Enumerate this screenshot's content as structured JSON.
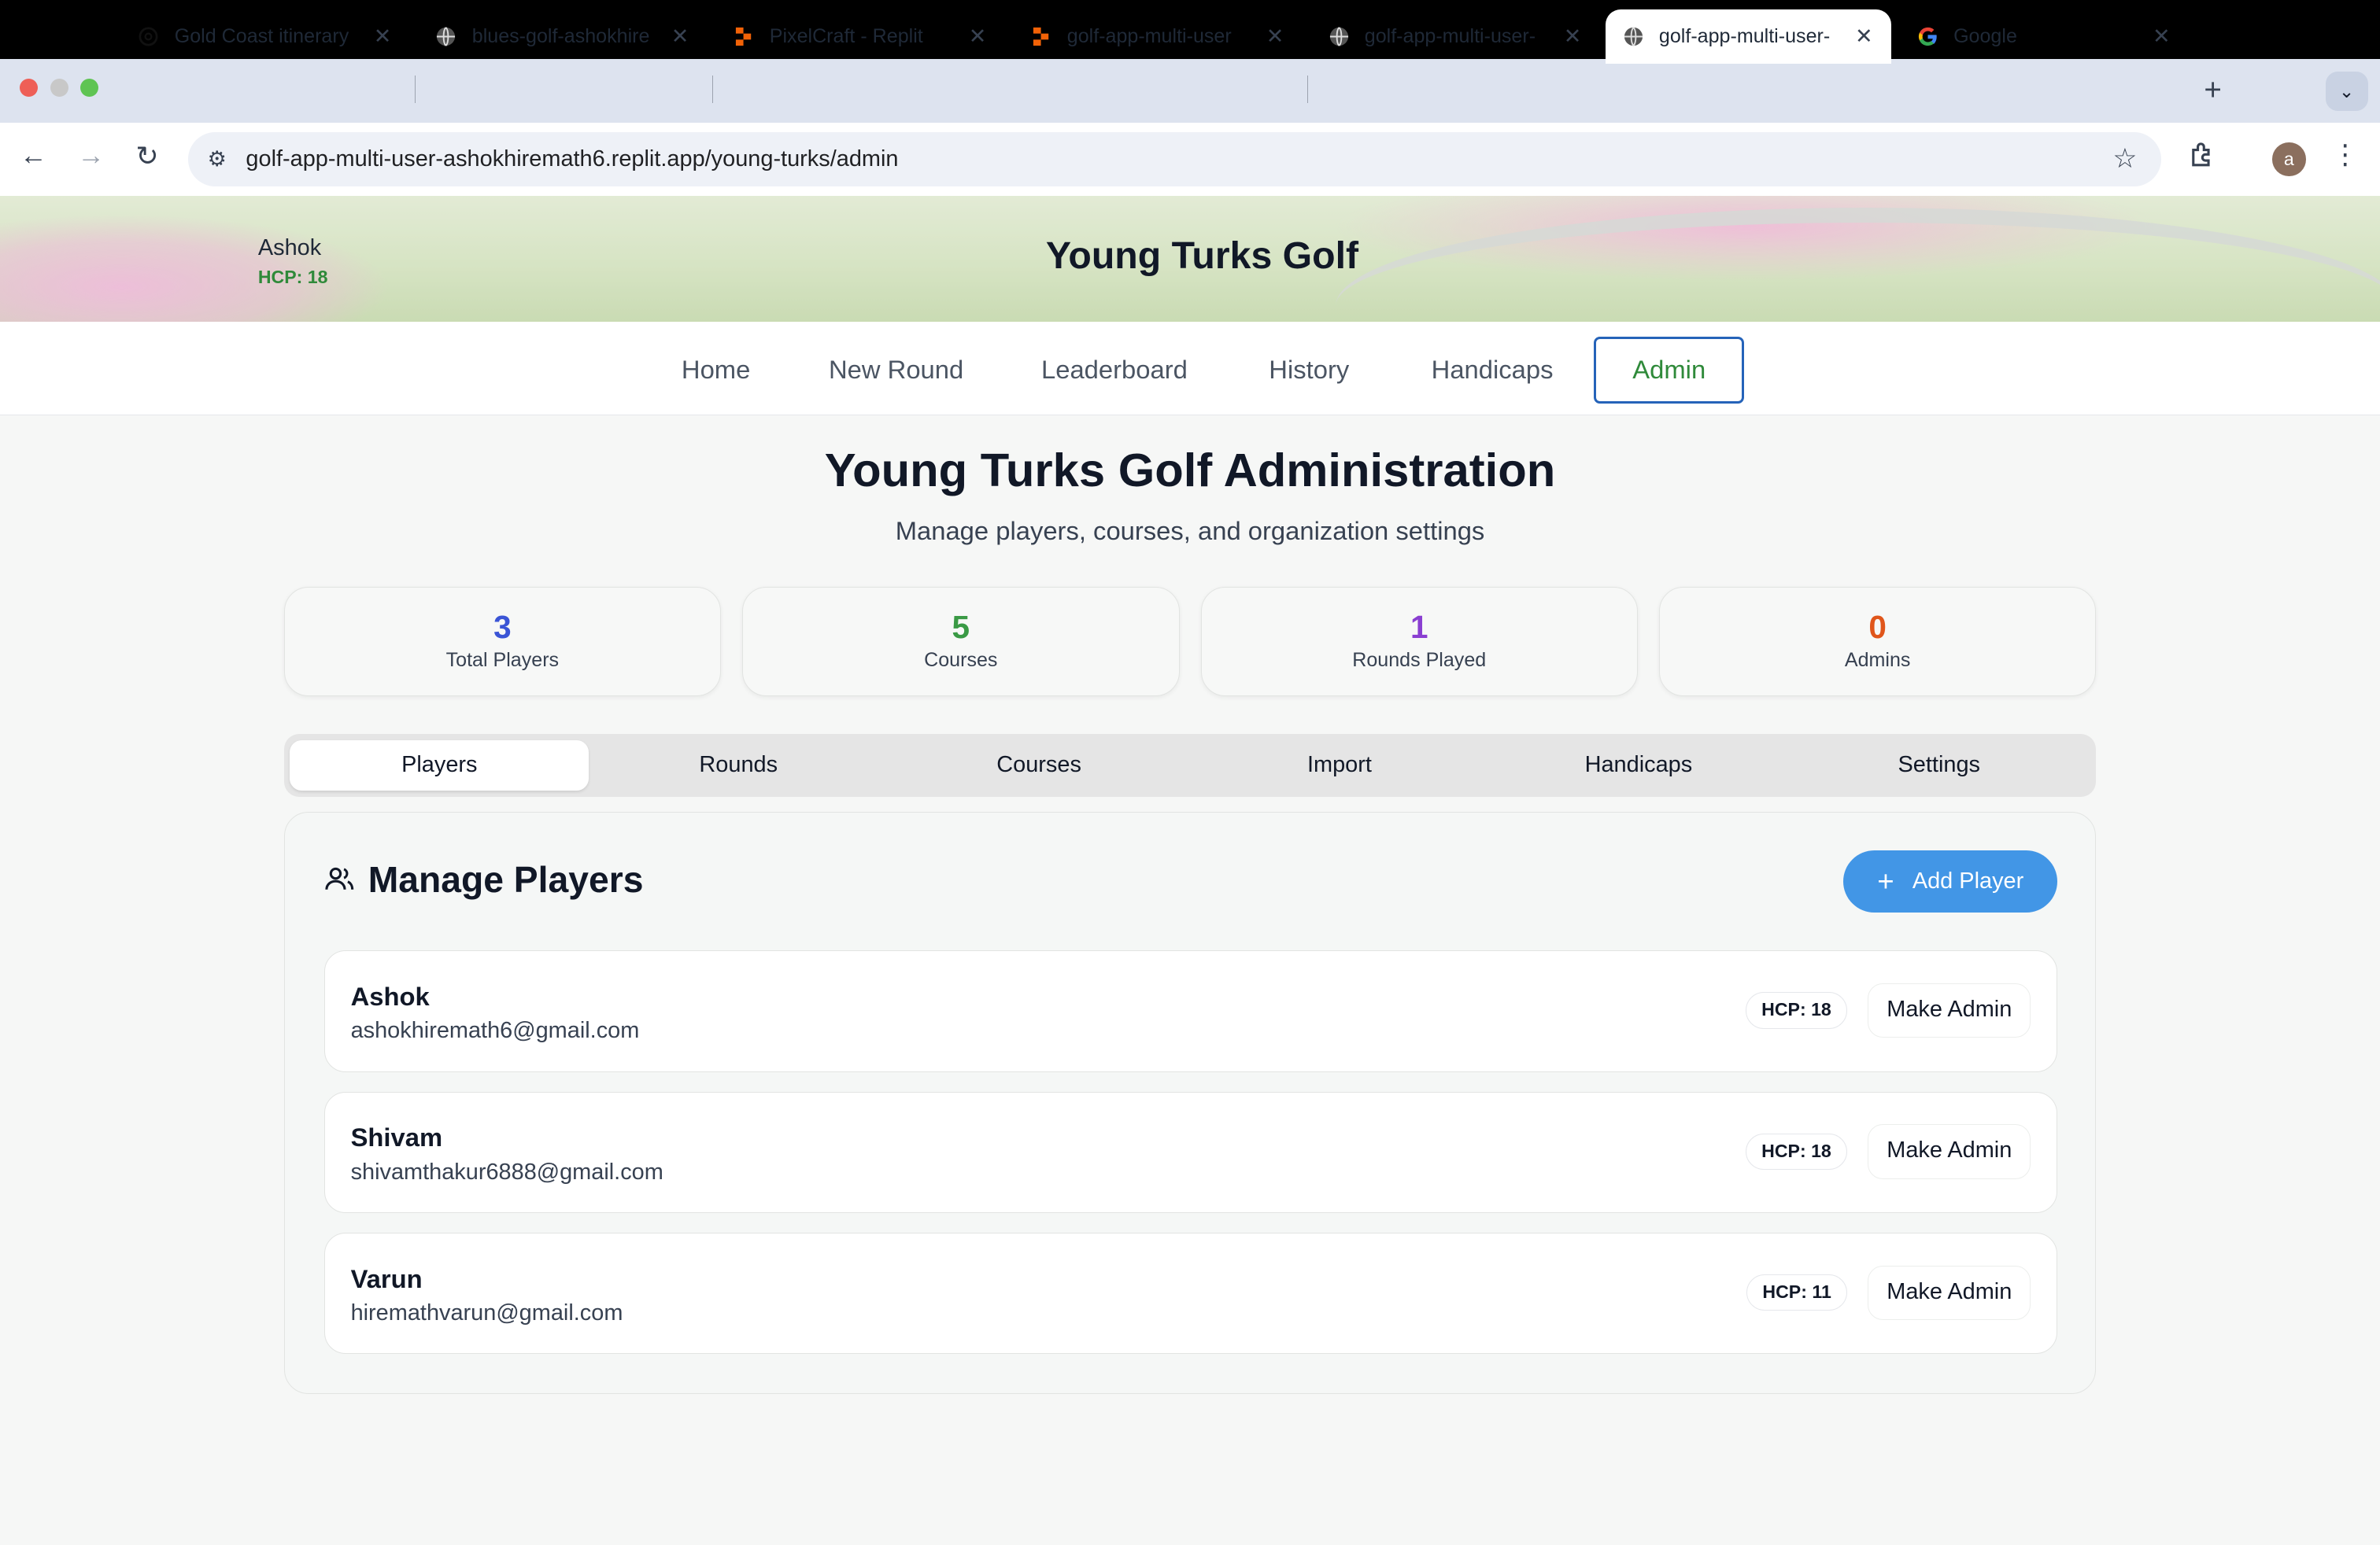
{
  "browser": {
    "tabs": [
      {
        "title": "Gold Coast itinerary",
        "icon": "openai-icon"
      },
      {
        "title": "blues-golf-ashokhire",
        "icon": "globe-icon"
      },
      {
        "title": "PixelCraft - Replit",
        "icon": "replit-icon"
      },
      {
        "title": "golf-app-multi-user",
        "icon": "replit-icon"
      },
      {
        "title": "golf-app-multi-user-",
        "icon": "globe-icon"
      },
      {
        "title": "golf-app-multi-user-",
        "icon": "globe-icon",
        "active": true
      },
      {
        "title": "Google",
        "icon": "google-icon"
      }
    ],
    "url_host": "golf-app-multi-user-ashokhiremath6.replit.app",
    "url_path": "/young-turks/admin",
    "profile_initial": "a"
  },
  "header": {
    "user_name": "Ashok",
    "user_hcp": "HCP: 18",
    "site_title": "Young Turks Golf"
  },
  "nav": {
    "items": [
      "Home",
      "New Round",
      "Leaderboard",
      "History",
      "Handicaps",
      "Admin"
    ],
    "active": "Admin"
  },
  "page": {
    "heading": "Young Turks Golf Administration",
    "subheading": "Manage players, courses, and organization settings"
  },
  "stats": [
    {
      "value": "3",
      "label": "Total Players",
      "color": "#3b55d6"
    },
    {
      "value": "5",
      "label": "Courses",
      "color": "#3a9a45"
    },
    {
      "value": "1",
      "label": "Rounds Played",
      "color": "#8a3fd1"
    },
    {
      "value": "0",
      "label": "Admins",
      "color": "#e0561b"
    }
  ],
  "admin_tabs": {
    "items": [
      "Players",
      "Rounds",
      "Courses",
      "Import",
      "Handicaps",
      "Settings"
    ],
    "active": "Players"
  },
  "players_panel": {
    "title": "Manage Players",
    "add_button": "Add Player",
    "players": [
      {
        "name": "Ashok",
        "email": "ashokhiremath6@gmail.com",
        "hcp": "HCP: 18",
        "action": "Make Admin"
      },
      {
        "name": "Shivam",
        "email": "shivamthakur6888@gmail.com",
        "hcp": "HCP: 18",
        "action": "Make Admin"
      },
      {
        "name": "Varun",
        "email": "hiremathvarun@gmail.com",
        "hcp": "HCP: 11",
        "action": "Make Admin"
      }
    ]
  }
}
